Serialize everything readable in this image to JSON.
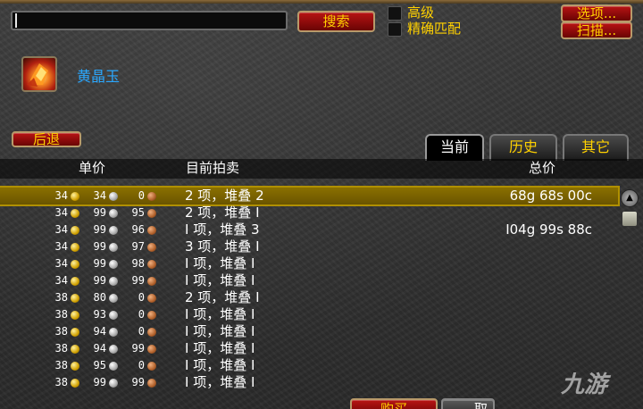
{
  "header": {
    "search_value": "",
    "search_label": "搜索",
    "advanced_label": "高级",
    "exact_label": "精确匹配",
    "options_label": "选项...",
    "scan_label": "扫描..."
  },
  "item": {
    "name": "黄晶玉",
    "icon": "gem-icon"
  },
  "nav": {
    "back_label": "后退"
  },
  "tabs": [
    {
      "label": "当前",
      "active": true
    },
    {
      "label": "历史",
      "active": false
    },
    {
      "label": "其它",
      "active": false
    }
  ],
  "columns": {
    "unit_price": "单价",
    "current_auction": "目前拍卖",
    "total_price": "总价"
  },
  "rows": [
    {
      "gold": "34",
      "silver": "34",
      "copper": "0",
      "desc": "2 项，堆叠 2",
      "total": "68g 68s 00c",
      "selected": true
    },
    {
      "gold": "34",
      "silver": "99",
      "copper": "95",
      "desc": "2 项，堆叠 I",
      "total": ""
    },
    {
      "gold": "34",
      "silver": "99",
      "copper": "96",
      "desc": "I 项，堆叠 3",
      "total": "I04g 99s 88c"
    },
    {
      "gold": "34",
      "silver": "99",
      "copper": "97",
      "desc": "3 项，堆叠 I",
      "total": ""
    },
    {
      "gold": "34",
      "silver": "99",
      "copper": "98",
      "desc": "I 项，堆叠 I",
      "total": ""
    },
    {
      "gold": "34",
      "silver": "99",
      "copper": "99",
      "desc": "I 项，堆叠 I",
      "total": ""
    },
    {
      "gold": "38",
      "silver": "80",
      "copper": "0",
      "desc": "2 项，堆叠 I",
      "total": ""
    },
    {
      "gold": "38",
      "silver": "93",
      "copper": "0",
      "desc": "I 项，堆叠 I",
      "total": ""
    },
    {
      "gold": "38",
      "silver": "94",
      "copper": "0",
      "desc": "I 项，堆叠 I",
      "total": ""
    },
    {
      "gold": "38",
      "silver": "94",
      "copper": "99",
      "desc": "I 项，堆叠 I",
      "total": ""
    },
    {
      "gold": "38",
      "silver": "95",
      "copper": "0",
      "desc": "I 项，堆叠 I",
      "total": ""
    },
    {
      "gold": "38",
      "silver": "99",
      "copper": "99",
      "desc": "I 项，堆叠 I",
      "total": ""
    }
  ],
  "footer": {
    "buy_label": "购买",
    "cancel_label": "取"
  },
  "watermark": "九游",
  "colors": {
    "gold_text": "#ffd100",
    "item_name": "#2aa8ff",
    "button_red": "#9a0a0a",
    "selected_row": "#7a6200"
  }
}
